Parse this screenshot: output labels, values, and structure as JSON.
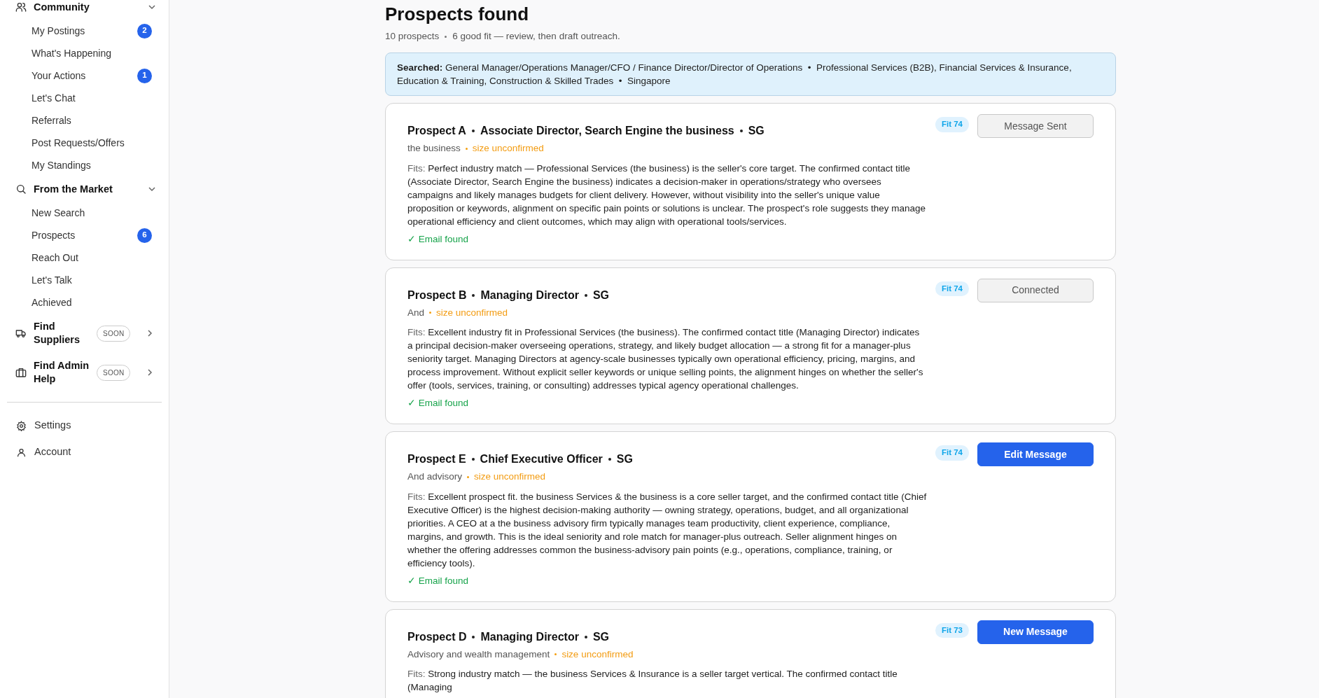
{
  "sidebar": {
    "groups": [
      {
        "label": "Community",
        "expanded": true,
        "items": [
          {
            "label": "My Postings",
            "badge": "2"
          },
          {
            "label": "What's Happening"
          },
          {
            "label": "Your Actions",
            "badge": "1"
          },
          {
            "label": "Let's Chat"
          },
          {
            "label": "Referrals"
          },
          {
            "label": "Post Requests/Offers"
          },
          {
            "label": "My Standings"
          }
        ]
      },
      {
        "label": "From the Market",
        "expanded": true,
        "items": [
          {
            "label": "New Search"
          },
          {
            "label": "Prospects",
            "badge": "6"
          },
          {
            "label": "Reach Out"
          },
          {
            "label": "Let's Talk"
          },
          {
            "label": "Achieved"
          }
        ]
      },
      {
        "label": "Find Suppliers",
        "expanded": false,
        "tag": "SOON"
      },
      {
        "label": "Find Admin Help",
        "expanded": false,
        "tag": "SOON"
      }
    ],
    "footer": [
      {
        "label": "Settings"
      },
      {
        "label": "Account"
      }
    ]
  },
  "header": {
    "title": "Prospects found",
    "count": "10 prospects",
    "summary": "6 good fit — review, then draft outreach."
  },
  "search_summary": "**Searched:** General Manager/Operations Manager/CFO / Finance Director/Director of Operations  •  Professional Services (B2B), Financial Services & Insurance, Education & Training, Construction & Skilled Trades  •  Singapore",
  "prospects": [
    {
      "name": "Prospect A",
      "title": "Associate Director, Search Engine the business",
      "region": "SG",
      "company": "the business",
      "size_note": "size unconfirmed",
      "fit": "Fit 74",
      "fits_label": "Fits:",
      "description": "Perfect industry match — Professional Services (the business) is the seller's core target. The confirmed contact title (Associate Director, Search Engine the business) indicates a decision-maker in operations/strategy who oversees campaigns and likely manages budgets for client delivery. However, without visibility into the seller's unique value proposition or keywords, alignment on specific pain points or solutions is unclear. The prospect's role suggests they manage operational efficiency and client outcomes, which may align with operational tools/services.",
      "email": "✓ Email found",
      "action": {
        "label": "Message Sent",
        "kind": "done"
      }
    },
    {
      "name": "Prospect B",
      "title": "Managing Director",
      "region": "SG",
      "company": "And",
      "size_note": "size unconfirmed",
      "fit": "Fit 74",
      "fits_label": "Fits:",
      "description": "Excellent industry fit in Professional Services (the business). The confirmed contact title (Managing Director) indicates a principal decision-maker overseeing operations, strategy, and likely budget allocation — a strong fit for a manager-plus seniority target. Managing Directors at agency-scale businesses typically own operational efficiency, pricing, margins, and process improvement. Without explicit seller keywords or unique selling points, the alignment hinges on whether the seller's offer (tools, services, training, or consulting) addresses typical agency operational challenges.",
      "email": "✓ Email found",
      "action": {
        "label": "Connected",
        "kind": "done"
      }
    },
    {
      "name": "Prospect E",
      "title": "Chief Executive Officer",
      "region": "SG",
      "company": "And advisory",
      "size_note": "size unconfirmed",
      "fit": "Fit 74",
      "fits_label": "Fits:",
      "description": "Excellent prospect fit. the business Services & the business is a core seller target, and the confirmed contact title (Chief Executive Officer) is the highest decision-making authority — owning strategy, operations, budget, and all organizational priorities. A CEO at a the business advisory firm typically manages team productivity, client experience, compliance, margins, and growth. This is the ideal seniority and role match for manager-plus outreach. Seller alignment hinges on whether the offering addresses common the business-advisory pain points (e.g., operations, compliance, training, or efficiency tools).",
      "email": "✓ Email found",
      "action": {
        "label": "Edit Message",
        "kind": "primary"
      }
    },
    {
      "name": "Prospect D",
      "title": "Managing Director",
      "region": "SG",
      "company": "Advisory and wealth management",
      "size_note": "size unconfirmed",
      "fit": "Fit 73",
      "fits_label": "Fits:",
      "description": "Strong industry match — the business Services & Insurance is a seller target vertical. The confirmed contact title (Managing",
      "action": {
        "label": "New Message",
        "kind": "primary"
      }
    }
  ]
}
